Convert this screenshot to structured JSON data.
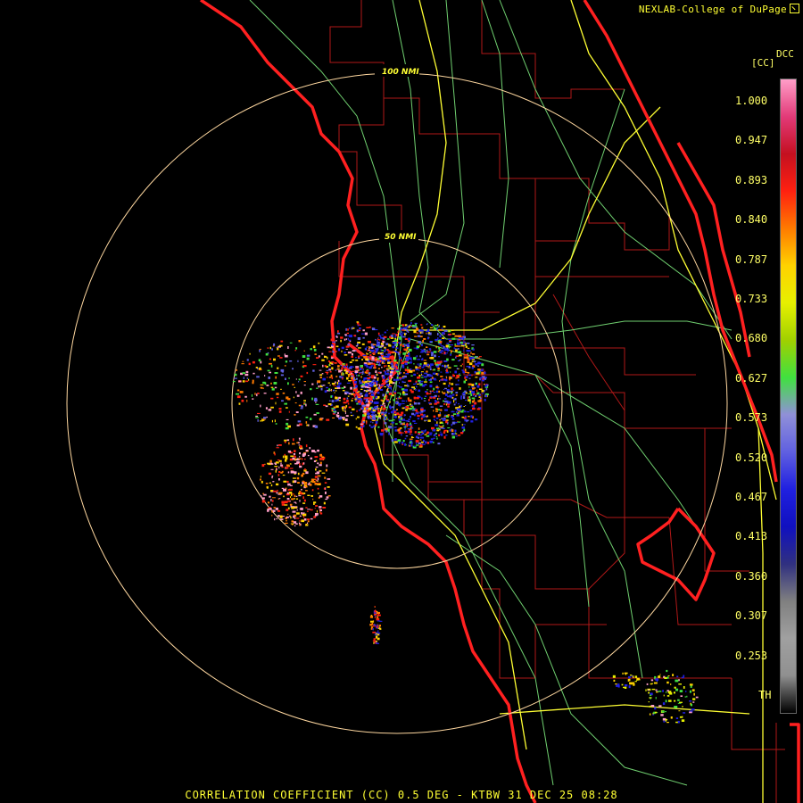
{
  "credit": "NEXLAB-College of DuPage",
  "colorbar": {
    "units": "[CC]",
    "product": "DCC",
    "ticks": [
      "1.000",
      "0.947",
      "0.893",
      "0.840",
      "0.787",
      "0.733",
      "0.680",
      "0.627",
      "0.573",
      "0.520",
      "0.467",
      "0.413",
      "0.360",
      "0.307",
      "0.253",
      "TH"
    ],
    "colors": [
      "#ff9ec8",
      "#e23a78",
      "#c41020",
      "#ff2010",
      "#ff7a00",
      "#ffd200",
      "#e6f000",
      "#a0d000",
      "#40e040",
      "#9090d8",
      "#6060e0",
      "#2020e0",
      "#1010c0",
      "#303080",
      "#808080",
      "#a0a0a0",
      "#909090",
      "#000000"
    ]
  },
  "rings": [
    {
      "label": "100 NMI"
    },
    {
      "label": "50 NMI"
    }
  ],
  "footer": "CORRELATION COEFFICIENT (CC) 0.5 DEG - KTBW 31 DEC 25 08:28",
  "colors": {
    "coastline": "#ff2020",
    "county": "#c02020",
    "highway": "#ffff33",
    "road": "#80e080",
    "ring": "#ffd8a0",
    "echo": [
      "#2020e0",
      "#6060e0",
      "#ff2010",
      "#ff7a00",
      "#ffd200",
      "#40e040",
      "#ff9ec8",
      "#e6f000"
    ]
  }
}
